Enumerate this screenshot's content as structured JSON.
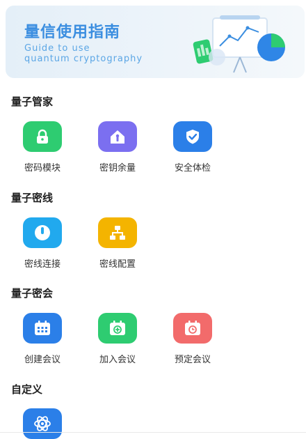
{
  "banner": {
    "title": "量信使用指南",
    "subtitle_line1": "Guide to use",
    "subtitle_line2": "quantum cryptography"
  },
  "sections": [
    {
      "title": "量子管家",
      "apps": [
        {
          "label": "密码模块",
          "icon": "lock-icon",
          "color": "#2ecc71"
        },
        {
          "label": "密钥余量",
          "icon": "key-house-icon",
          "color": "#7b6ff0"
        },
        {
          "label": "安全体检",
          "icon": "shield-check-icon",
          "color": "#2b7fe8"
        }
      ]
    },
    {
      "title": "量子密线",
      "apps": [
        {
          "label": "密线连接",
          "icon": "power-icon",
          "color": "#21a9ee"
        },
        {
          "label": "密线配置",
          "icon": "network-icon",
          "color": "#f4b400"
        }
      ]
    },
    {
      "title": "量子密会",
      "apps": [
        {
          "label": "创建会议",
          "icon": "calendar-icon",
          "color": "#2b7fe8"
        },
        {
          "label": "加入会议",
          "icon": "calendar-plus-icon",
          "color": "#2ecc71"
        },
        {
          "label": "预定会议",
          "icon": "calendar-clock-icon",
          "color": "#f26b6b"
        }
      ]
    },
    {
      "title": "自定义",
      "apps": [
        {
          "label": "",
          "icon": "atom-icon",
          "color": "#2b7fe8"
        }
      ]
    }
  ]
}
